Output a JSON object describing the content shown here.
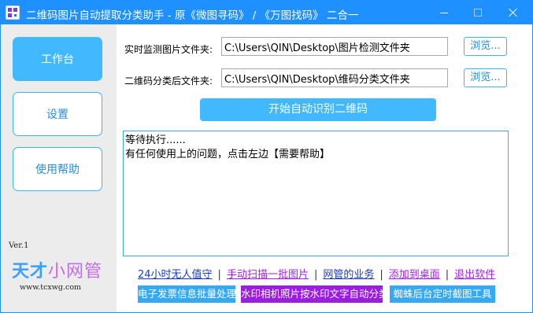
{
  "window": {
    "title": "二维码图片自动提取分类助手 - 原《微图寻码》 / 《万图找码》 二合一"
  },
  "sidebar": {
    "items": [
      {
        "label": "工作台"
      },
      {
        "label": "设置"
      },
      {
        "label": "使用帮助"
      }
    ],
    "version": "Ver.1",
    "brand_main": "天才",
    "brand_accent": "小网管",
    "brand_url": "www.tcxwg.com"
  },
  "form": {
    "monitor_label": "实时监测图片文件夹:",
    "monitor_path": "C:\\Users\\QIN\\Desktop\\图片检测文件夹",
    "output_label": "二维码分类后文件夹:",
    "output_path": "C:\\Users\\QIN\\Desktop\\维码分类文件夹",
    "browse_label": "浏览...",
    "start_label": "开始自动识别二维码"
  },
  "log": {
    "lines": [
      "等待执行......",
      "有任何使用上的问题，点击左边【需要帮助】"
    ]
  },
  "links": [
    {
      "label": "24小时无人值守",
      "color": "#1a3cc8"
    },
    {
      "label": "手动扫描一批图片",
      "color": "#a020f0"
    },
    {
      "label": "网管的业务",
      "color": "#1a3cc8"
    },
    {
      "label": "添加到桌面",
      "color": "#a020f0"
    },
    {
      "label": "退出软件",
      "color": "#a020f0"
    }
  ],
  "badges": [
    {
      "label": "电子发票信息批量处理",
      "color": "#36a9f5"
    },
    {
      "label": "水印相机照片按水印文字自动分类",
      "color": "#9b1ee0"
    },
    {
      "label": "蜘蛛后台定时截图工具",
      "color": "#36a9f5"
    }
  ],
  "colors": {
    "titlebar": "#1e90ff",
    "accent": "#42b8ff",
    "sidebar_bg": "#ececec"
  }
}
